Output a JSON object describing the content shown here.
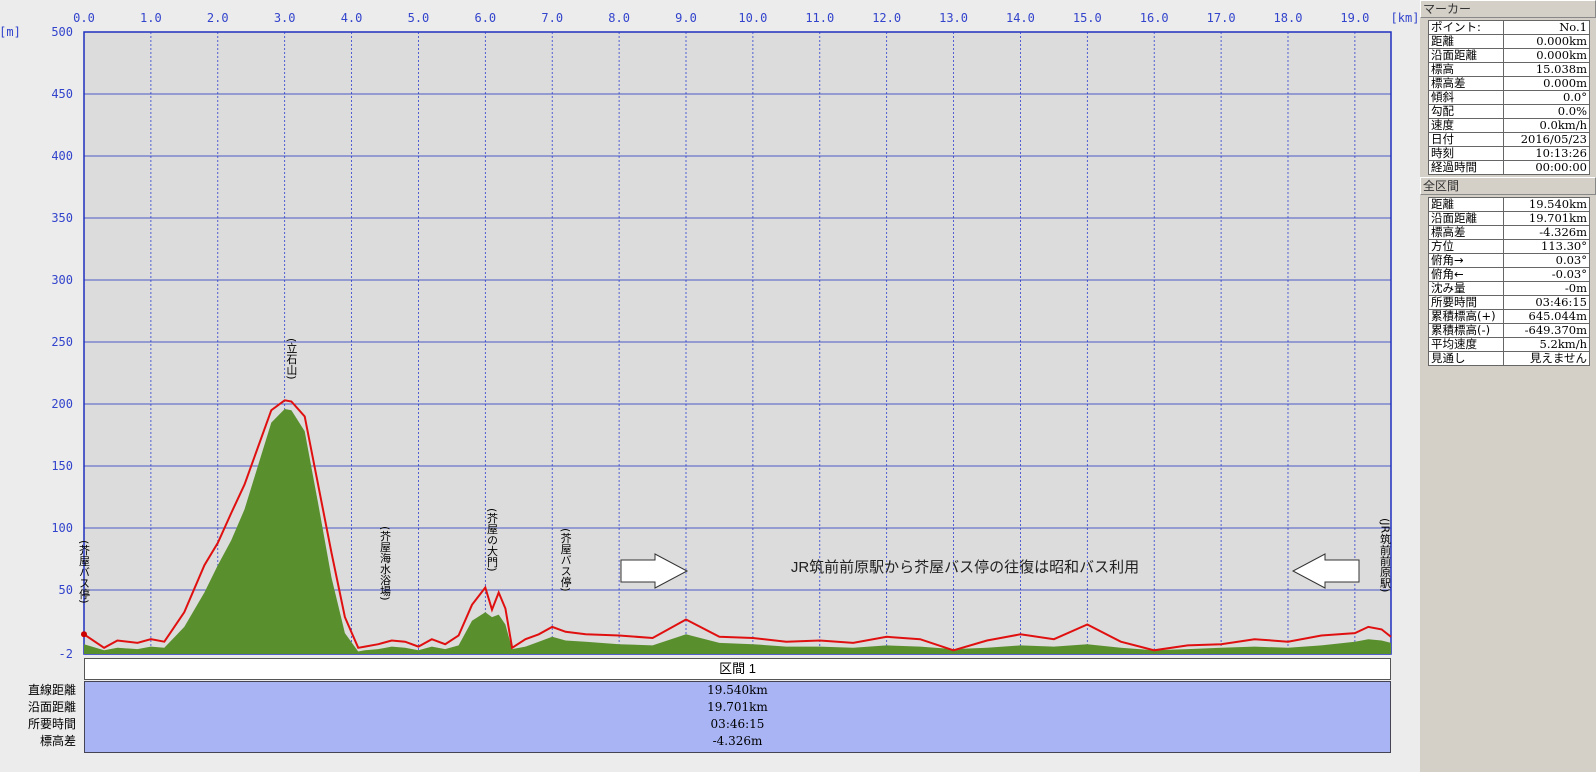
{
  "chart_data": {
    "type": "area",
    "x_unit": "[km]",
    "y_unit": "[m]",
    "xlim": [
      0,
      19.54
    ],
    "ylim": [
      -2,
      500
    ],
    "x_ticks": [
      "0.0",
      "1.0",
      "2.0",
      "3.0",
      "4.0",
      "5.0",
      "6.0",
      "7.0",
      "8.0",
      "9.0",
      "10.0",
      "11.0",
      "12.0",
      "13.0",
      "14.0",
      "15.0",
      "16.0",
      "17.0",
      "18.0",
      "19.0"
    ],
    "y_ticks": [
      "500",
      "450",
      "400",
      "350",
      "300",
      "250",
      "200",
      "150",
      "100",
      "50",
      "-2"
    ],
    "grid": true,
    "series": [
      {
        "color": "#e01010",
        "x": [
          0,
          0.3,
          0.5,
          0.8,
          1.0,
          1.2,
          1.5,
          1.8,
          2.0,
          2.2,
          2.4,
          2.6,
          2.8,
          3.0,
          3.1,
          3.3,
          3.5,
          3.7,
          3.9,
          4.1,
          4.2,
          4.4,
          4.6,
          4.8,
          5.0,
          5.2,
          5.4,
          5.6,
          5.8,
          6.0,
          6.1,
          6.2,
          6.3,
          6.4,
          6.6,
          6.8,
          7.0,
          7.2,
          7.5,
          8.0,
          8.5,
          9.0,
          9.5,
          10.0,
          10.5,
          11.0,
          11.5,
          12.0,
          12.5,
          13.0,
          13.5,
          14.0,
          14.5,
          15.0,
          15.5,
          16.0,
          16.5,
          17.0,
          17.5,
          18.0,
          18.5,
          19.0,
          19.2,
          19.4,
          19.54
        ],
        "y": [
          14,
          3,
          9,
          7,
          10,
          8,
          32,
          70,
          88,
          112,
          135,
          165,
          195,
          203,
          202,
          190,
          135,
          80,
          28,
          3,
          4,
          6,
          9,
          8,
          4,
          10,
          6,
          13,
          38,
          52,
          34,
          48,
          35,
          3,
          10,
          14,
          20,
          16,
          14,
          13,
          11,
          26,
          12,
          11,
          8,
          9,
          7,
          12,
          10,
          1,
          9,
          14,
          10,
          22,
          8,
          1,
          5,
          6,
          10,
          8,
          13,
          15,
          20,
          18,
          12
        ]
      },
      {
        "color": "#5a8f2e",
        "x": [
          0,
          0.3,
          0.5,
          0.8,
          1.0,
          1.2,
          1.5,
          1.8,
          2.0,
          2.2,
          2.4,
          2.6,
          2.8,
          3.0,
          3.1,
          3.3,
          3.5,
          3.7,
          3.9,
          4.1,
          4.2,
          4.4,
          4.6,
          4.8,
          5.0,
          5.2,
          5.4,
          5.6,
          5.8,
          6.0,
          6.1,
          6.2,
          6.3,
          6.4,
          6.6,
          6.8,
          7.0,
          7.2,
          7.5,
          8.0,
          8.5,
          9.0,
          9.5,
          10.0,
          10.5,
          11.0,
          11.5,
          12.0,
          12.5,
          13.0,
          13.5,
          14.0,
          14.5,
          15.0,
          15.5,
          16.0,
          16.5,
          17.0,
          17.5,
          18.0,
          18.5,
          19.0,
          19.2,
          19.4,
          19.54
        ],
        "y": [
          6,
          1,
          3,
          2,
          4,
          3,
          20,
          48,
          70,
          90,
          115,
          150,
          185,
          196,
          195,
          178,
          120,
          60,
          15,
          0,
          1,
          2,
          4,
          3,
          1,
          4,
          2,
          5,
          25,
          32,
          28,
          30,
          22,
          2,
          4,
          8,
          12,
          9,
          8,
          6,
          5,
          14,
          7,
          6,
          4,
          4,
          3,
          5,
          4,
          2,
          3,
          5,
          4,
          6,
          3,
          1,
          2,
          3,
          4,
          3,
          5,
          8,
          10,
          9,
          7
        ]
      }
    ],
    "annotations": [
      {
        "label": "(芥屋バス停)",
        "x": 0.0
      },
      {
        "label": "(立石山)",
        "x": 3.1
      },
      {
        "label": "(芥屋海水浴場)",
        "x": 4.5
      },
      {
        "label": "(芥屋の大門)",
        "x": 6.1
      },
      {
        "label": "(芥屋バス停)",
        "x": 7.2
      },
      {
        "label": "(JR筑前前原駅)",
        "x": 19.45
      }
    ],
    "note": "JR筑前前原駅から芥屋バス停の往復は昭和バス利用"
  },
  "section": {
    "title": "区間 1",
    "rows": [
      {
        "label": "直線距離",
        "value": "19.540km"
      },
      {
        "label": "沿面距離",
        "value": "19.701km"
      },
      {
        "label": "所要時間",
        "value": "03:46:15"
      },
      {
        "label": "標高差",
        "value": "-4.326m"
      }
    ]
  },
  "panel": {
    "marker_title": "マーカー",
    "marker_rows": [
      {
        "k": "ポイント:",
        "v": "No.1"
      },
      {
        "k": "距離",
        "v": "0.000km"
      },
      {
        "k": "沿面距離",
        "v": "0.000km"
      },
      {
        "k": "標高",
        "v": "15.038m"
      },
      {
        "k": "標高差",
        "v": "0.000m"
      },
      {
        "k": "傾斜",
        "v": "0.0°"
      },
      {
        "k": "勾配",
        "v": "0.0%"
      },
      {
        "k": "速度",
        "v": "0.0km/h"
      },
      {
        "k": "日付",
        "v": "2016/05/23"
      },
      {
        "k": "時刻",
        "v": "10:13:26"
      },
      {
        "k": "経過時間",
        "v": "00:00:00"
      }
    ],
    "total_title": "全区間",
    "total_rows": [
      {
        "k": "距離",
        "v": "19.540km"
      },
      {
        "k": "沿面距離",
        "v": "19.701km"
      },
      {
        "k": "標高差",
        "v": "-4.326m"
      },
      {
        "k": "方位",
        "v": "113.30°"
      },
      {
        "k": "俯角→",
        "v": "0.03°"
      },
      {
        "k": "俯角←",
        "v": "-0.03°"
      },
      {
        "k": "沈み量",
        "v": "-0m"
      },
      {
        "k": "所要時間",
        "v": "03:46:15"
      },
      {
        "k": "累積標高(+)",
        "v": "645.044m"
      },
      {
        "k": "累積標高(-)",
        "v": "-649.370m"
      },
      {
        "k": "平均速度",
        "v": "5.2km/h"
      },
      {
        "k": "見通し",
        "v": "見えません"
      }
    ]
  }
}
